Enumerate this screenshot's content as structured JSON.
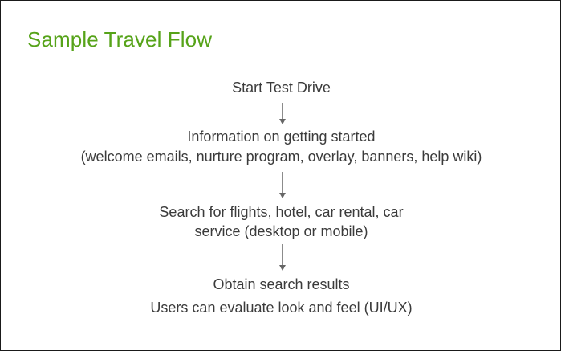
{
  "title": "Sample Travel Flow",
  "flow": {
    "step1": "Start Test Drive",
    "step2_line1": "Information on getting started",
    "step2_line2": "(welcome emails, nurture program, overlay, banners, help wiki)",
    "step3_line1": "Search for  flights, hotel, car rental, car",
    "step3_line2": "service (desktop or mobile)",
    "step4_line1": "Obtain search results",
    "step4_line2": "Users can evaluate look and feel (UI/UX)"
  },
  "colors": {
    "title": "#56a319",
    "text": "#3b3b3b",
    "arrow": "#666666",
    "border": "#1a1a1a"
  }
}
